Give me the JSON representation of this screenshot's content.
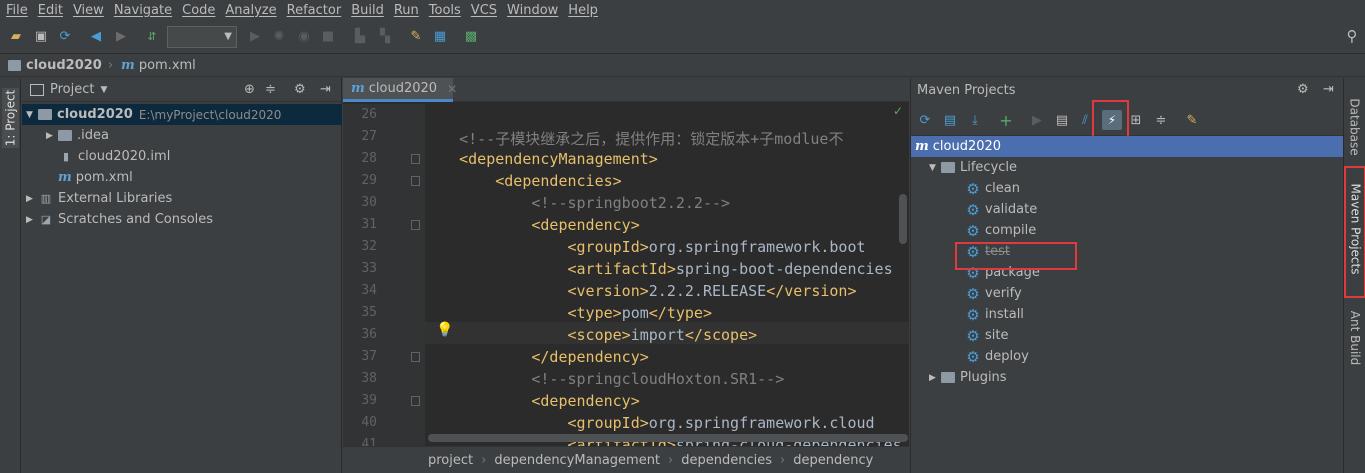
{
  "menu": [
    "File",
    "Edit",
    "View",
    "Navigate",
    "Code",
    "Analyze",
    "Refactor",
    "Build",
    "Run",
    "Tools",
    "VCS",
    "Window",
    "Help"
  ],
  "toolbar": {
    "icons": [
      "open-icon",
      "save-icon",
      "sync-icon",
      "back-icon",
      "forward-icon",
      "build-icon",
      "run-config-select",
      "run-icon",
      "debug-icon",
      "coverage-icon",
      "stop-icon",
      "attach-icon",
      "project-structure-icon",
      "settings-icon",
      "sdk-icon",
      "vcs-icon",
      "search-icon"
    ]
  },
  "navbar": {
    "project": "cloud2020",
    "file": "pom.xml"
  },
  "left_stripe": {
    "project_tab": "1: Project"
  },
  "project_panel": {
    "title": "Project",
    "tree": [
      {
        "label": "cloud2020",
        "path": "E:\\myProject\\cloud2020",
        "level": 0,
        "expanded": true,
        "kind": "module",
        "selected": true
      },
      {
        "label": ".idea",
        "level": 1,
        "expanded": false,
        "kind": "folder"
      },
      {
        "label": "cloud2020.iml",
        "level": 1,
        "kind": "iml"
      },
      {
        "label": "pom.xml",
        "level": 1,
        "kind": "maven"
      },
      {
        "label": "External Libraries",
        "level": 0,
        "expanded": false,
        "kind": "libraries"
      },
      {
        "label": "Scratches and Consoles",
        "level": 0,
        "expanded": false,
        "kind": "scratches"
      }
    ]
  },
  "editor": {
    "tab_label": "cloud2020",
    "lines": [
      {
        "n": "26",
        "html": ""
      },
      {
        "n": "27",
        "indent": "    ",
        "comment": "<!--子模块继承之后，提供作用：锁定版本+子modlue不"
      },
      {
        "n": "28",
        "indent": "    ",
        "tag": "<dependencyManagement>"
      },
      {
        "n": "29",
        "indent": "        ",
        "tag": "<dependencies>"
      },
      {
        "n": "30",
        "indent": "            ",
        "comment": "<!--springboot2.2.2-->"
      },
      {
        "n": "31",
        "indent": "            ",
        "tag": "<dependency>"
      },
      {
        "n": "32",
        "indent": "                ",
        "open": "<groupId>",
        "text": "org.springframework.boot"
      },
      {
        "n": "33",
        "indent": "                ",
        "open": "<artifactId>",
        "text": "spring-boot-dependencies"
      },
      {
        "n": "34",
        "indent": "                ",
        "open": "<version>",
        "text": "2.2.2.RELEASE",
        "close": "</version>"
      },
      {
        "n": "35",
        "indent": "                ",
        "open": "<type>",
        "text": "pom",
        "close": "</type>"
      },
      {
        "n": "36",
        "indent": "                ",
        "open": "<scope>",
        "text": "import",
        "close": "</scope>"
      },
      {
        "n": "37",
        "indent": "            ",
        "tag": "</dependency>"
      },
      {
        "n": "38",
        "indent": "            ",
        "comment": "<!--springcloudHoxton.SR1-->"
      },
      {
        "n": "39",
        "indent": "            ",
        "tag": "<dependency>"
      },
      {
        "n": "40",
        "indent": "                ",
        "open": "<groupId>",
        "text": "org.springframework.cloud"
      },
      {
        "n": "41",
        "indent": "                ",
        "open": "<artifactId>",
        "text": "spring-cloud-dependencies"
      }
    ],
    "breadcrumb": [
      "project",
      "dependencyManagement",
      "dependencies",
      "dependency"
    ]
  },
  "maven_panel": {
    "title": "Maven Projects",
    "root": "cloud2020",
    "lifecycle_label": "Lifecycle",
    "lifecycle": [
      "clean",
      "validate",
      "compile",
      "test",
      "package",
      "verify",
      "install",
      "site",
      "deploy"
    ],
    "plugins_label": "Plugins",
    "skip_tests_highlighted": true,
    "test_struck_through": true
  },
  "right_stripe": [
    "Database",
    "Maven Projects",
    "Ant Build"
  ],
  "colors": {
    "highlight_box": "#e0393e",
    "selection": "#4b6eaf",
    "tag": "#e8bf6a",
    "comment": "#808080"
  }
}
